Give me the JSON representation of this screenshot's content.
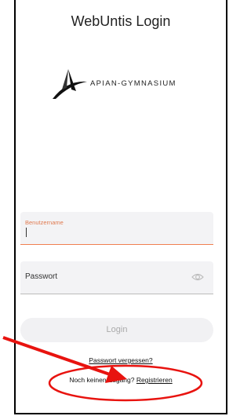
{
  "header": {
    "title": "WebUntis Login"
  },
  "logo": {
    "text": "APIAN-GYMNASIUM"
  },
  "form": {
    "username_label": "Benutzername",
    "username_value": "",
    "password_label": "Passwort",
    "password_value": "",
    "login_label": "Login"
  },
  "links": {
    "forgot_password": "Passwort vergessen?",
    "no_access_prefix": "Noch keinen Zugang?",
    "register": "Registrieren"
  },
  "colors": {
    "accent": "#f08050",
    "annotation": "#e8130f"
  },
  "icons": {
    "password_toggle": "eye-icon"
  }
}
